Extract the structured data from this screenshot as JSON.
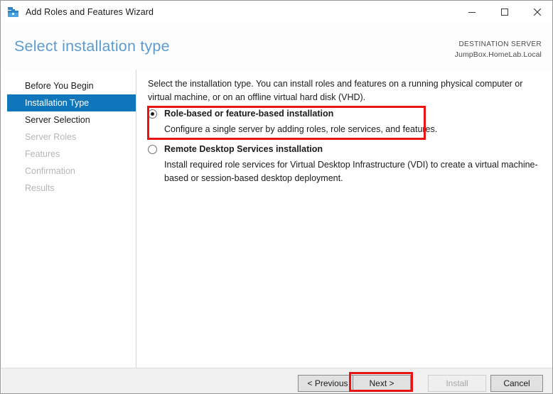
{
  "window": {
    "title": "Add Roles and Features Wizard",
    "app_icon": "server-toolbox-icon",
    "controls": {
      "minimize": "minimize-icon",
      "maximize": "maximize-icon",
      "close": "close-icon"
    }
  },
  "header": {
    "page_title": "Select installation type",
    "destination_label": "DESTINATION SERVER",
    "destination_server": "JumpBox.HomeLab.Local",
    "title_color": "#5c9bd1"
  },
  "sidebar": {
    "items": [
      {
        "label": "Before You Begin",
        "state": "enabled"
      },
      {
        "label": "Installation Type",
        "state": "selected"
      },
      {
        "label": "Server Selection",
        "state": "enabled"
      },
      {
        "label": "Server Roles",
        "state": "disabled"
      },
      {
        "label": "Features",
        "state": "disabled"
      },
      {
        "label": "Confirmation",
        "state": "disabled"
      },
      {
        "label": "Results",
        "state": "disabled"
      }
    ],
    "selected_bg": "#1076bc"
  },
  "main": {
    "intro": "Select the installation type. You can install roles and features on a running physical computer or virtual machine, or on an offline virtual hard disk (VHD).",
    "options": [
      {
        "title": "Role-based or feature-based installation",
        "description": "Configure a single server by adding roles, role services, and features.",
        "selected": true
      },
      {
        "title": "Remote Desktop Services installation",
        "description": "Install required role services for Virtual Desktop Infrastructure (VDI) to create a virtual machine-based or session-based desktop deployment.",
        "selected": false
      }
    ],
    "watermark": "· · · · · ·"
  },
  "annotations": {
    "highlight_color": "#e81313",
    "highlighted_targets": [
      "role-based-option",
      "next-button"
    ]
  },
  "footer": {
    "buttons": [
      {
        "label": "< Previous",
        "enabled": true
      },
      {
        "label": "Next >",
        "enabled": true
      },
      {
        "label": "Install",
        "enabled": false
      },
      {
        "label": "Cancel",
        "enabled": true
      }
    ]
  }
}
